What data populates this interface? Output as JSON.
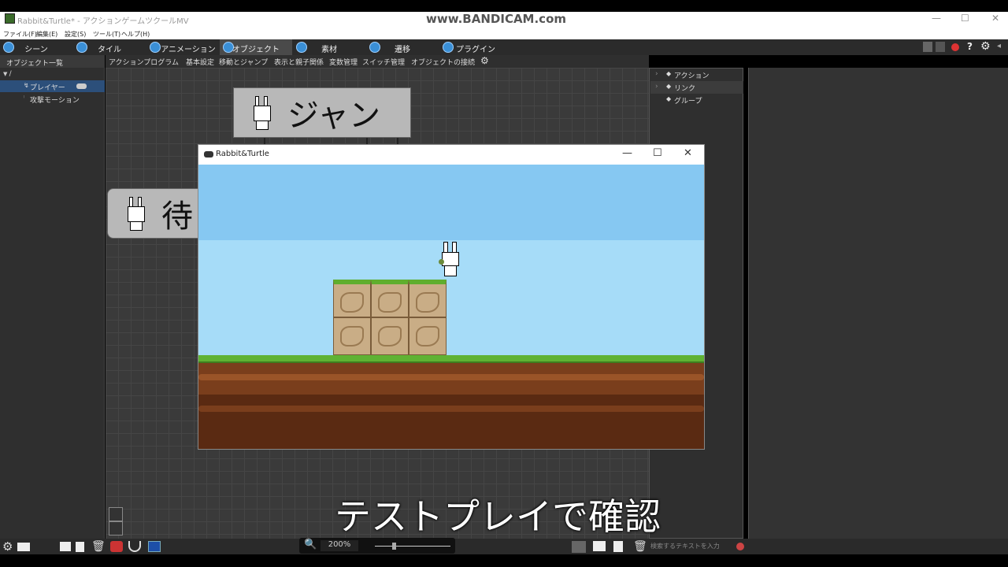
{
  "window": {
    "title": "Rabbit&Turtle* - アクションゲームツクールMV",
    "watermark": "www.BANDICAM.com",
    "controls": {
      "minimize": "—",
      "maximize": "☐",
      "close": "✕"
    }
  },
  "menu": [
    "ファイル(F)",
    "編集(E)",
    "設定(S)",
    "ツール(T)",
    "ヘルプ(H)"
  ],
  "tabs": [
    "シーン",
    "タイル",
    "アニメーション",
    "オブジェクト",
    "素材",
    "遷移",
    "プラグイン"
  ],
  "active_tab": "オブジェクト",
  "left_panel": {
    "header": "オブジェクト一覧",
    "root": "/",
    "items": [
      "プレイヤー",
      "攻撃モーション"
    ]
  },
  "canvas": {
    "tabs": [
      "アクションプログラム",
      "基本設定",
      "移動とジャンプ",
      "表示と親子関係",
      "変数管理",
      "スイッチ管理",
      "オブジェクトの接続"
    ],
    "nodes": {
      "jump": "ジャンプ",
      "wait": "待"
    }
  },
  "right_panel": {
    "items": [
      "アクション",
      "リンク",
      "グループ"
    ]
  },
  "game_window": {
    "title": "Rabbit&Turtle",
    "controls": {
      "minimize": "—",
      "maximize": "☐",
      "close": "✕"
    }
  },
  "status": {
    "zoom": "200%",
    "search_placeholder": "検索するテキストを入力"
  },
  "subtitle": "テストプレイで確認",
  "colors": {
    "sky_top": "#86c8f2",
    "sky_bottom": "#a6dcf8",
    "grass": "#5fb233",
    "dirt": "#7a3e1c",
    "selection": "#2c4f7a"
  },
  "icons": [
    "app-icon",
    "scene-icon",
    "tile-icon",
    "animation-icon",
    "object-icon",
    "material-icon",
    "transition-icon",
    "plugin-icon",
    "play-icon",
    "stop-icon",
    "record-icon",
    "help-icon",
    "settings-icon",
    "gamepad-icon",
    "zoom-icon",
    "trash-icon"
  ]
}
